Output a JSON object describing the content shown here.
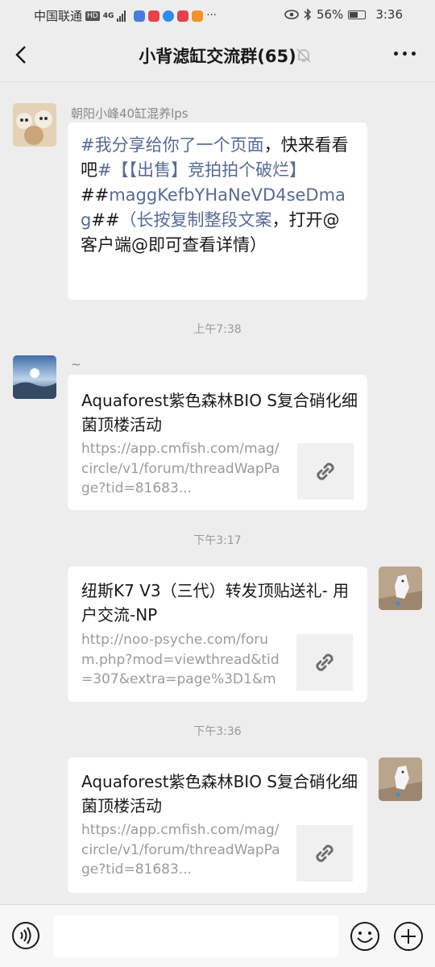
{
  "status": {
    "carrier": "中国联通",
    "hd": "HD",
    "net": "4G",
    "battery": "56%",
    "time": "3:36"
  },
  "nav": {
    "title": "小背滤缸交流群(65)"
  },
  "messages": [
    {
      "sender": "朝阳小峰40缸混养lps",
      "text_parts": [
        "#我分享给你了一个页面",
        "，快来看看吧",
        "#【【出售】竞拍拍个破烂】",
        "##",
        "maggKefbYHaNeVD4seDmag",
        "##",
        "（长按复制整段文案",
        "，打开@客户端@即可查看详情）"
      ]
    },
    {
      "timestamp": "上午7:38"
    },
    {
      "sender": "~",
      "card_title": "Aquaforest紫色森林BIO S复合硝化细菌顶楼活动",
      "card_url": "https://app.cmfish.com/mag/circle/v1/forum/threadWapPage?tid=81683..."
    },
    {
      "timestamp": "下午3:17"
    },
    {
      "card_title": "纽斯K7 V3（三代）转发顶贴送礼- 用户交流-NP",
      "card_url": "http://noo-psyche.com/forum.php?mod=viewthread&tid=307&extra=page%3D1&mo..."
    },
    {
      "timestamp": "下午3:36"
    },
    {
      "card_title": "Aquaforest紫色森林BIO S复合硝化细菌顶楼活动",
      "card_url": "https://app.cmfish.com/mag/circle/v1/forum/threadWapPage?tid=81683..."
    }
  ],
  "colors": {
    "background": "#ededed",
    "bubble": "#ffffff",
    "link": "#576b95",
    "muted": "#9a9a9a"
  }
}
